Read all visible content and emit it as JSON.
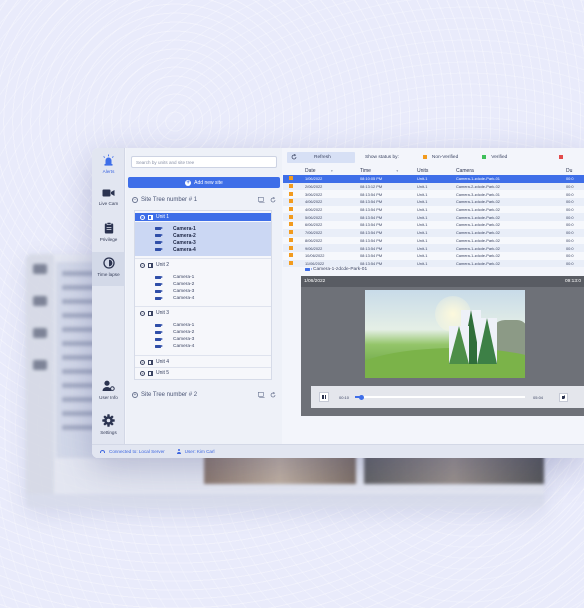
{
  "colors": {
    "accent": "#3e6ee8",
    "non_verified": "#f29b1e",
    "verified": "#3fbf5a",
    "alarm": "#e24b4b"
  },
  "rail": [
    {
      "label": "Alerts",
      "icon": "alarm-siren-icon"
    },
    {
      "label": "Live Cam",
      "icon": "video-camera-icon"
    },
    {
      "label": "Privilege",
      "icon": "clipboard-icon"
    },
    {
      "label": "Time lapse",
      "icon": "time-lapse-icon"
    },
    {
      "label": "User Info",
      "icon": "user-settings-icon"
    },
    {
      "label": "Settings",
      "icon": "gear-icon"
    }
  ],
  "tree": {
    "search_placeholder": "Search by units and site tree",
    "add_site_label": "Add new site",
    "sites": [
      {
        "name": "Site Tree number # 1"
      },
      {
        "name": "Site Tree number # 2"
      }
    ],
    "units": [
      {
        "name": "Unit 1",
        "cameras": [
          "Camera-1",
          "Camera-2",
          "Camera-3",
          "Camera-4"
        ]
      },
      {
        "name": "Unit 2",
        "cameras": [
          "Camera-1",
          "Camera-2",
          "Camera-3",
          "Camera-4"
        ]
      },
      {
        "name": "Unit 3",
        "cameras": [
          "Camera-1",
          "Camera-2",
          "Camera-3",
          "Camera-4"
        ]
      },
      {
        "name": "Unit 4"
      },
      {
        "name": "Unit 5"
      }
    ]
  },
  "toolbar": {
    "refresh_label": "Refresh",
    "status_label": "Show status by:",
    "legend": [
      "Non-Verified",
      "Verified"
    ]
  },
  "table": {
    "columns": [
      "Date",
      "Time",
      "Units",
      "Camera",
      "Du"
    ],
    "rows": [
      [
        "1/06/2022",
        "08:10:05 PM",
        "Unit-1",
        "Camera-1-zdcde-Park-01",
        "00:0"
      ],
      [
        "2/06/2022",
        "08:13:12 PM",
        "Unit-1",
        "Camera-2-zdcde-Park-02",
        "00:0"
      ],
      [
        "3/06/2022",
        "08:13:54 PM",
        "Unit-1",
        "Camera-3-zdcde-Park-01",
        "00:0"
      ],
      [
        "4/06/2022",
        "08:13:54 PM",
        "Unit-1",
        "Camera-1-zdcde-Park-02",
        "00:0"
      ],
      [
        "4/06/2022",
        "08:13:54 PM",
        "Unit-1",
        "Camera-1-zdcde-Park-02",
        "00:0"
      ],
      [
        "5/06/2022",
        "08:13:54 PM",
        "Unit-1",
        "Camera-1-zdcde-Park-02",
        "00:0"
      ],
      [
        "6/06/2022",
        "08:13:54 PM",
        "Unit-1",
        "Camera-1-zdcde-Park-02",
        "00:0"
      ],
      [
        "7/06/2022",
        "08:13:54 PM",
        "Unit-1",
        "Camera-1-zdcde-Park-02",
        "00:0"
      ],
      [
        "8/06/2022",
        "08:13:54 PM",
        "Unit-1",
        "Camera-1-zdcde-Park-02",
        "00:0"
      ],
      [
        "9/06/2022",
        "08:13:54 PM",
        "Unit-1",
        "Camera-1-zdcde-Park-02",
        "00:0"
      ],
      [
        "10/06/2022",
        "08:13:54 PM",
        "Unit-1",
        "Camera-1-zdcde-Park-02",
        "00:0"
      ],
      [
        "11/06/2022",
        "08:13:54 PM",
        "Unit-1",
        "Camera-1-zdcde-Park-02",
        "00:0"
      ]
    ]
  },
  "player": {
    "clip_title": "Camera-1-zdcde-Park-01",
    "date": "1/06/2022",
    "timestamp": "09:13:0",
    "current_time": "00:10",
    "end_time": "05:04",
    "progress": 0.04
  },
  "statusbar": {
    "connection": "Connected to: Local Server",
    "user": "User: Kim Carl"
  }
}
